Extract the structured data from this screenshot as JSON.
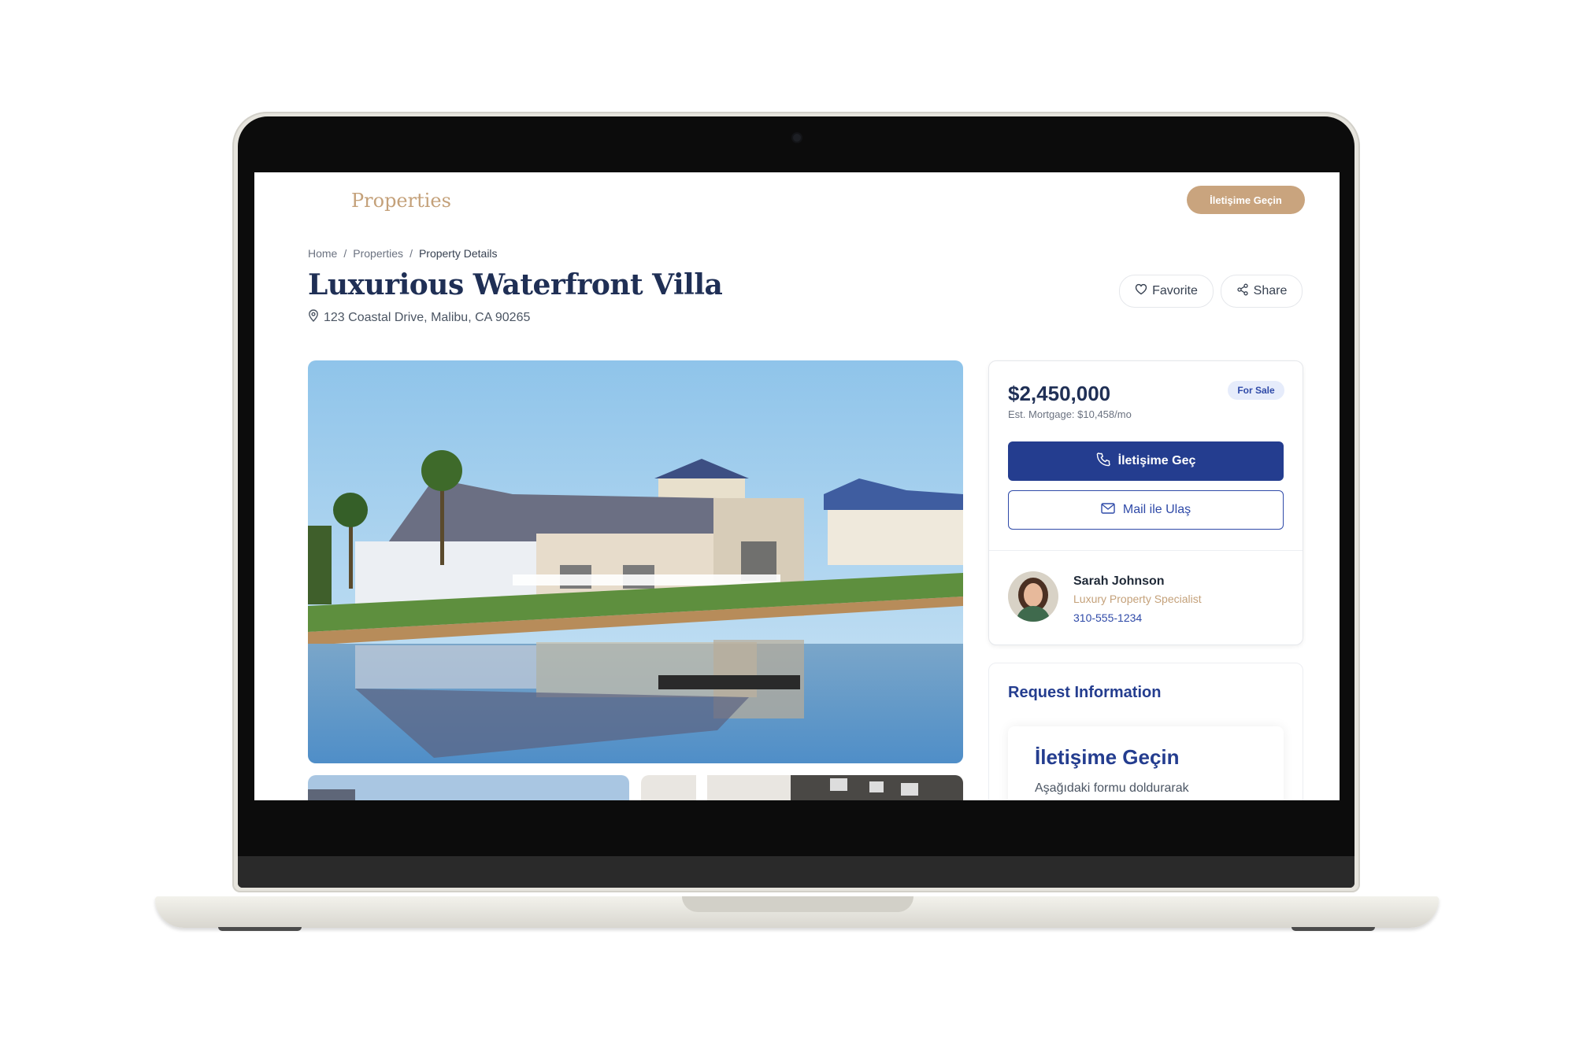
{
  "header": {
    "brand": "Properties",
    "contact_button": "İletişime Geçin"
  },
  "breadcrumb": {
    "items": [
      "Home",
      "Properties",
      "Property Details"
    ],
    "separator": "/"
  },
  "listing": {
    "title": "Luxurious Waterfront Villa",
    "address": "123 Coastal Drive, Malibu, CA 90265",
    "favorite_label": "Favorite",
    "share_label": "Share"
  },
  "price_card": {
    "price": "$2,450,000",
    "mortgage": "Est. Mortgage: $10,458/mo",
    "status_badge": "For Sale",
    "call_button": "İletişime Geç",
    "mail_button": "Mail ile Ulaş"
  },
  "agent": {
    "name": "Sarah Johnson",
    "role": "Luxury Property Specialist",
    "phone": "310-555-1234"
  },
  "request_info": {
    "title": "Request Information",
    "form_title": "İletişime Geçin",
    "form_description": "Aşağıdaki formu doldurarak"
  },
  "colors": {
    "brand_gold": "#c4a17a",
    "primary_navy": "#243d8f",
    "title_navy": "#1f2f55"
  }
}
